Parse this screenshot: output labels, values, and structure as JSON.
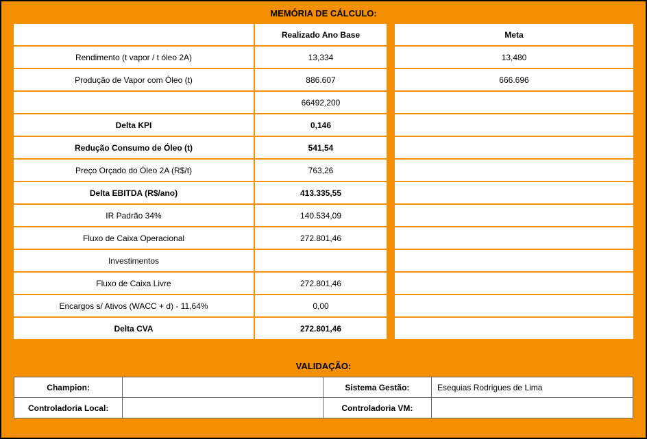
{
  "section_calc_title": "MEMÓRIA DE CÁLCULO:",
  "headers": {
    "label": "",
    "realizado": "Realizado Ano Base",
    "meta": "Meta"
  },
  "rows": [
    {
      "label": "Rendimento (t vapor / t óleo 2A)",
      "bold": false,
      "realizado": "13,334",
      "meta": "13,480"
    },
    {
      "label": "Produção de Vapor com Óleo (t)",
      "bold": false,
      "realizado": "886.607",
      "meta": "666.696"
    },
    {
      "label": "",
      "bold": false,
      "realizado": "66492,200",
      "meta": ""
    },
    {
      "label": "Delta KPI",
      "bold": true,
      "realizado": "0,146",
      "meta": ""
    },
    {
      "label": "Redução Consumo de Óleo (t)",
      "bold": true,
      "realizado": "541,54",
      "meta": ""
    },
    {
      "label": "Preço Orçado do Óleo 2A (R$/t)",
      "bold": false,
      "realizado": "763,26",
      "meta": ""
    },
    {
      "label": "Delta EBITDA (R$/ano)",
      "bold": true,
      "realizado": "413.335,55",
      "meta": ""
    },
    {
      "label": "IR Padrão 34%",
      "bold": false,
      "realizado": "140.534,09",
      "meta": ""
    },
    {
      "label": "Fluxo de Caixa Operacional",
      "bold": false,
      "realizado": "272.801,46",
      "meta": ""
    },
    {
      "label": "Investimentos",
      "bold": false,
      "realizado": "",
      "meta": ""
    },
    {
      "label": "Fluxo de Caixa Livre",
      "bold": false,
      "realizado": "272.801,46",
      "meta": ""
    },
    {
      "label": "Encargos s/ Ativos (WACC + d) - 11,64%",
      "bold": false,
      "realizado": "0,00",
      "meta": ""
    },
    {
      "label": "Delta CVA",
      "bold": true,
      "realizado": "272.801,46",
      "meta": ""
    }
  ],
  "section_validation_title": "VALIDAÇÃO:",
  "validation": {
    "champion_label": "Champion:",
    "champion_value": "",
    "sistema_label": "Sistema Gestão:",
    "sistema_value": "Esequias Rodrigues de Lima",
    "contr_local_label": "Controladoria Local:",
    "contr_local_value": "",
    "contr_vm_label": "Controladoria VM:",
    "contr_vm_value": ""
  }
}
